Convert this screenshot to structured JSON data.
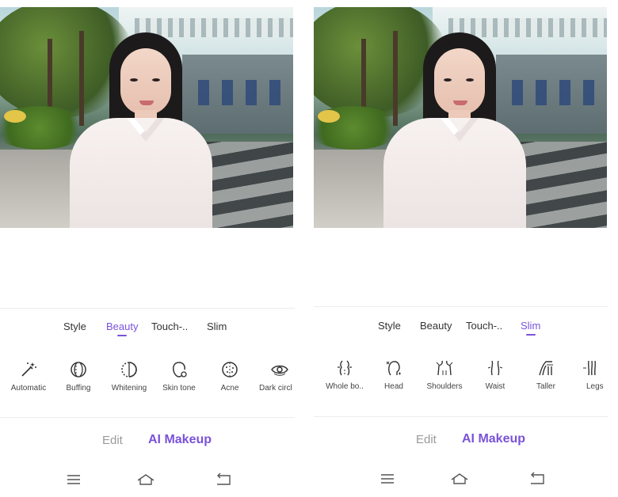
{
  "screens": [
    {
      "id": "beauty",
      "subtabs": [
        {
          "label": "Style",
          "active": false
        },
        {
          "label": "Beauty",
          "active": true
        },
        {
          "label": "Touch-..",
          "active": false
        },
        {
          "label": "Slim",
          "active": false
        }
      ],
      "tools": [
        {
          "label": "Automatic",
          "icon": "magic-wand-icon"
        },
        {
          "label": "Buffing",
          "icon": "buffing-icon"
        },
        {
          "label": "Whitening",
          "icon": "whitening-icon"
        },
        {
          "label": "Skin tone",
          "icon": "skin-tone-icon"
        },
        {
          "label": "Acne",
          "icon": "acne-icon"
        },
        {
          "label": "Dark circl",
          "icon": "eye-icon"
        }
      ],
      "main_tabs": [
        {
          "label": "Edit",
          "active": false
        },
        {
          "label": "AI Makeup",
          "active": true
        }
      ]
    },
    {
      "id": "slim",
      "subtabs": [
        {
          "label": "Style",
          "active": false
        },
        {
          "label": "Beauty",
          "active": false
        },
        {
          "label": "Touch-..",
          "active": false
        },
        {
          "label": "Slim",
          "active": true
        }
      ],
      "tools": [
        {
          "label": "Whole bo..",
          "icon": "whole-body-icon"
        },
        {
          "label": "Head",
          "icon": "head-icon"
        },
        {
          "label": "Shoulders",
          "icon": "shoulders-icon"
        },
        {
          "label": "Waist",
          "icon": "waist-icon"
        },
        {
          "label": "Taller",
          "icon": "taller-icon"
        },
        {
          "label": "Legs",
          "icon": "legs-icon"
        }
      ],
      "main_tabs": [
        {
          "label": "Edit",
          "active": false
        },
        {
          "label": "AI Makeup",
          "active": true
        }
      ]
    }
  ],
  "nav_bar": {
    "icons": [
      "menu-icon",
      "home-icon",
      "back-icon"
    ]
  },
  "colors": {
    "accent": "#7a52d9",
    "text": "#333333",
    "muted": "#9a9a9a"
  }
}
